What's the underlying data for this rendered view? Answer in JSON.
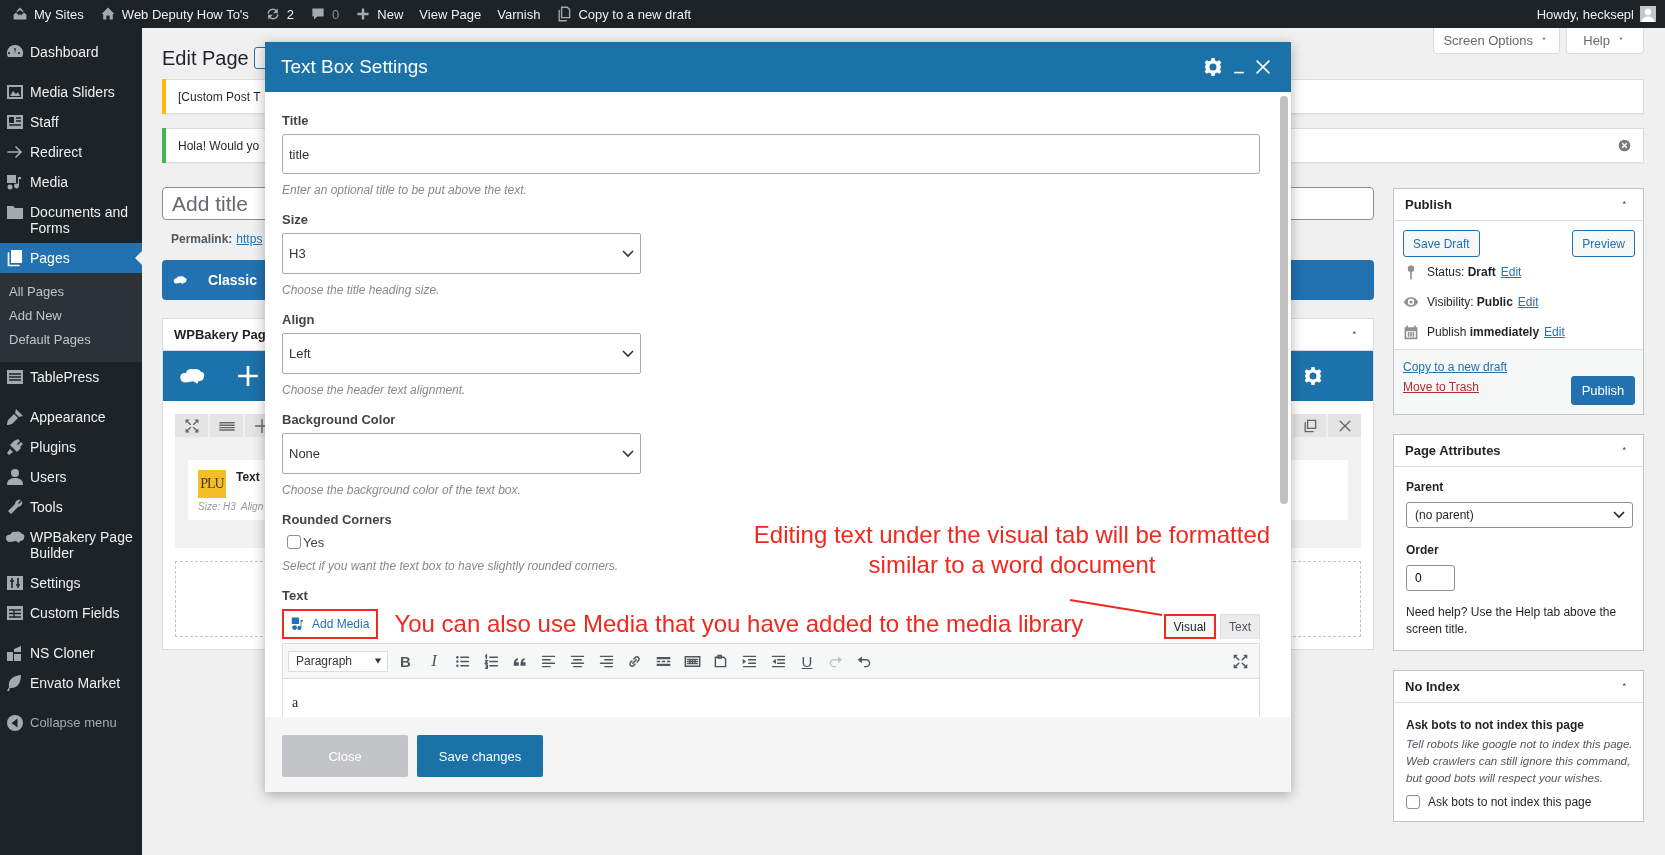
{
  "admin_bar": {
    "items": [
      {
        "kind": "sites",
        "label": "My Sites"
      },
      {
        "kind": "home",
        "label": "Web Deputy How To's"
      },
      {
        "kind": "updates",
        "label": "2"
      },
      {
        "kind": "comments",
        "label": "0"
      },
      {
        "kind": "new",
        "label": "New"
      },
      {
        "kind": "plain",
        "label": "View Page"
      },
      {
        "kind": "plain",
        "label": "Varnish"
      },
      {
        "kind": "copy",
        "label": "Copy to a new draft"
      }
    ],
    "greeting": "Howdy, hecksepl"
  },
  "sidebar": {
    "groups": [
      [
        {
          "label": "Dashboard",
          "selected": false
        }
      ],
      [
        {
          "label": "Media Sliders",
          "selected": false
        },
        {
          "label": "Staff",
          "selected": false
        },
        {
          "label": "Redirect",
          "selected": false
        },
        {
          "label": "Media",
          "selected": false
        },
        {
          "label": "Documents and Forms",
          "selected": false
        },
        {
          "label": "Pages",
          "selected": true,
          "children": [
            {
              "label": "All Pages",
              "selected": false
            },
            {
              "label": "Add New",
              "selected": false
            },
            {
              "label": "Default Pages",
              "selected": false
            }
          ]
        },
        {
          "label": "TablePress",
          "selected": false
        }
      ],
      [
        {
          "label": "Appearance",
          "selected": false
        },
        {
          "label": "Plugins",
          "selected": false
        },
        {
          "label": "Users",
          "selected": false
        },
        {
          "label": "Tools",
          "selected": false
        },
        {
          "label": "WPBakery Page Builder",
          "selected": false
        },
        {
          "label": "Settings",
          "selected": false
        },
        {
          "label": "Custom Fields",
          "selected": false
        }
      ],
      [
        {
          "label": "NS Cloner",
          "selected": false
        },
        {
          "label": "Envato Market",
          "selected": false
        }
      ]
    ],
    "collapse": "Collapse menu"
  },
  "screen_links": [
    "Screen Options",
    "Help"
  ],
  "page_title": "Edit Page",
  "notices": [
    {
      "text": "[Custom Post T",
      "color": "#ffb900",
      "dismissible": false
    },
    {
      "text": "Hola! Would yo",
      "color": "#46b450",
      "dismissible": true
    }
  ],
  "title_field": {
    "placeholder": "Add title"
  },
  "permalink": {
    "label": "Permalink:",
    "link": "https"
  },
  "classic_button": "Classic",
  "builder": {
    "title": "WPBakery Pag",
    "element": {
      "logo": "PLU",
      "name": "Text",
      "meta": "Size: H3  Align"
    }
  },
  "publish": {
    "title": "Publish",
    "save_draft": "Save Draft",
    "preview": "Preview",
    "rows": [
      {
        "kind": "status",
        "text": "Status: **Draft**",
        "link": "Edit"
      },
      {
        "kind": "visibility",
        "text": "Visibility: **Public**",
        "link": "Edit"
      },
      {
        "kind": "schedule",
        "text": "Publish **immediately**",
        "link": "Edit"
      }
    ],
    "copy_link": "Copy to a new draft",
    "trash_link": "Move to Trash",
    "publish_button": "Publish"
  },
  "page_attributes": {
    "title": "Page Attributes",
    "parent_label": "Parent",
    "parent_value": "(no parent)",
    "order_label": "Order",
    "order_value": "0",
    "help": "Need help? Use the Help tab above the screen title."
  },
  "no_index": {
    "title": "No Index",
    "heading": "Ask bots to not index this page",
    "description": "Tell robots like google not to index this page. Web crawlers can still ignore this command, but good bots will respect your wishes.",
    "checkbox": {
      "label": "Ask bots to not index this page",
      "checked": false
    }
  },
  "modal": {
    "title": "Text Box Settings",
    "fields": [
      {
        "kind": "text",
        "label": "Title",
        "value": "title",
        "help": "Enter an optional title to be put above the text."
      },
      {
        "kind": "select",
        "label": "Size",
        "value": "H3",
        "help": "Choose the title heading size."
      },
      {
        "kind": "select",
        "label": "Align",
        "value": "Left",
        "help": "Choose the header text alignment."
      },
      {
        "kind": "select",
        "label": "Background Color",
        "value": "None",
        "help": "Choose the background color of the text box."
      },
      {
        "kind": "checkbox",
        "label": "Rounded Corners",
        "option": "Yes",
        "checked": false,
        "help": "Select if you want the text box to have slightly rounded corners."
      }
    ],
    "editor": {
      "label": "Text",
      "add_media": {
        "label": "Add Media",
        "highlighted": true
      },
      "tabs": [
        {
          "label": "Visual",
          "selected": true,
          "highlighted": true
        },
        {
          "label": "Text",
          "selected": false,
          "highlighted": false
        }
      ],
      "format": "Paragraph",
      "tools": [
        {
          "kind": "bold",
          "label": "B",
          "disabled": false
        },
        {
          "kind": "italic",
          "label": "I",
          "disabled": false
        },
        {
          "kind": "bullets",
          "disabled": false
        },
        {
          "kind": "numbers",
          "disabled": false
        },
        {
          "kind": "quote",
          "disabled": false
        },
        {
          "kind": "align-left",
          "disabled": false
        },
        {
          "kind": "align-center",
          "disabled": false
        },
        {
          "kind": "align-right",
          "disabled": false
        },
        {
          "kind": "link",
          "disabled": false
        },
        {
          "kind": "more",
          "disabled": false
        },
        {
          "kind": "toolbar",
          "disabled": false
        },
        {
          "kind": "paste",
          "disabled": false
        },
        {
          "kind": "indent",
          "disabled": false
        },
        {
          "kind": "outdent",
          "disabled": false
        },
        {
          "kind": "underline",
          "label": "U",
          "disabled": false
        },
        {
          "kind": "redo",
          "disabled": true
        },
        {
          "kind": "undo",
          "disabled": false
        },
        {
          "kind": "fullscreen",
          "disabled": false
        }
      ],
      "content": "a"
    },
    "buttons": [
      {
        "kind": "secondary",
        "label": "Close"
      },
      {
        "kind": "primary",
        "label": "Save changes"
      }
    ]
  },
  "annotations": [
    {
      "kind": "callout",
      "text": "Editing text under the visual tab will be formatted similar to a word document"
    },
    {
      "kind": "inline",
      "text": "You can also use Media that you have added to the media library"
    }
  ]
}
